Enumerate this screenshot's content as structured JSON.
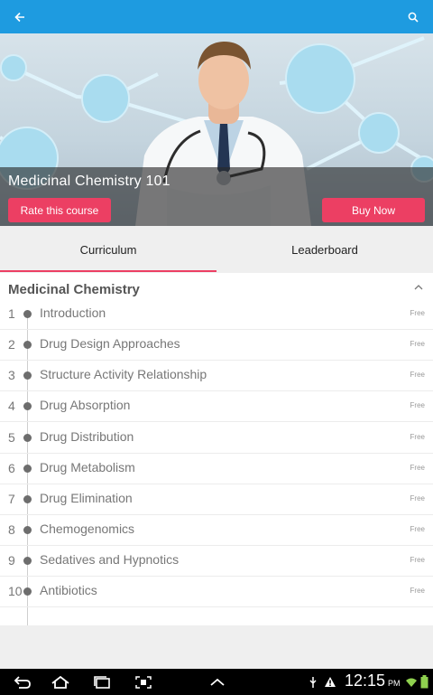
{
  "appbar": {
    "back_icon": "arrow-left-icon",
    "search_icon": "search-icon",
    "color": "#1e9be0"
  },
  "course": {
    "title": "Medicinal Chemistry 101",
    "rate_label": "Rate this course",
    "buy_label": "Buy Now",
    "accent": "#ec3f63"
  },
  "tabs": [
    {
      "label": "Curriculum",
      "selected": true
    },
    {
      "label": "Leaderboard",
      "selected": false
    }
  ],
  "section": {
    "title": "Medicinal Chemistry",
    "expanded": true,
    "items": [
      {
        "num": "1",
        "title": "Introduction",
        "badge": "Free"
      },
      {
        "num": "2",
        "title": "Drug Design Approaches",
        "badge": "Free"
      },
      {
        "num": "3",
        "title": "Structure Activity Relationship",
        "badge": "Free"
      },
      {
        "num": "4",
        "title": "Drug Absorption",
        "badge": "Free"
      },
      {
        "num": "5",
        "title": "Drug Distribution",
        "badge": "Free"
      },
      {
        "num": "6",
        "title": "Drug Metabolism",
        "badge": "Free"
      },
      {
        "num": "7",
        "title": "Drug Elimination",
        "badge": "Free"
      },
      {
        "num": "8",
        "title": "Chemogenomics",
        "badge": "Free"
      },
      {
        "num": "9",
        "title": "Sedatives and Hypnotics",
        "badge": "Free"
      },
      {
        "num": "10",
        "title": "Antibiotics",
        "badge": "Free"
      }
    ]
  },
  "system_bar": {
    "time": "12:15",
    "ampm": "PM"
  }
}
